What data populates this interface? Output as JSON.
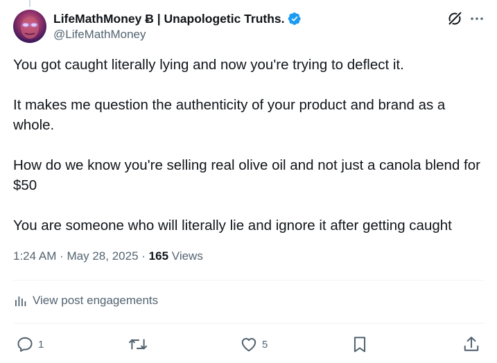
{
  "author": {
    "display_name": "LifeMathMoney Ƀ | Unapologetic Truths.",
    "handle": "@LifeMathMoney"
  },
  "post": {
    "paragraphs": [
      "You got caught literally lying and now you're trying to deflect it.",
      "It makes me question the authenticity of your product and brand as a whole.",
      "How do we know you're selling real olive oil and not just a canola blend for $50",
      "You are someone who will literally lie and ignore it after getting caught"
    ],
    "time": "1:24 AM",
    "separator": "·",
    "date": "May 28, 2025",
    "views_count": "165",
    "views_label": "Views"
  },
  "engagements_label": "View post engagements",
  "actions": {
    "reply_count": "1",
    "like_count": "5"
  },
  "icons": {
    "verified": "verified-badge-icon",
    "grok": "grok-icon",
    "more": "more-icon",
    "engagements": "bar-chart-icon",
    "reply": "reply-icon",
    "repost": "repost-icon",
    "like": "heart-icon",
    "bookmark": "bookmark-icon",
    "share": "share-icon"
  },
  "colors": {
    "text": "#0f1419",
    "secondary": "#536471",
    "verified": "#1d9bf0",
    "divider": "#eff3f4"
  }
}
